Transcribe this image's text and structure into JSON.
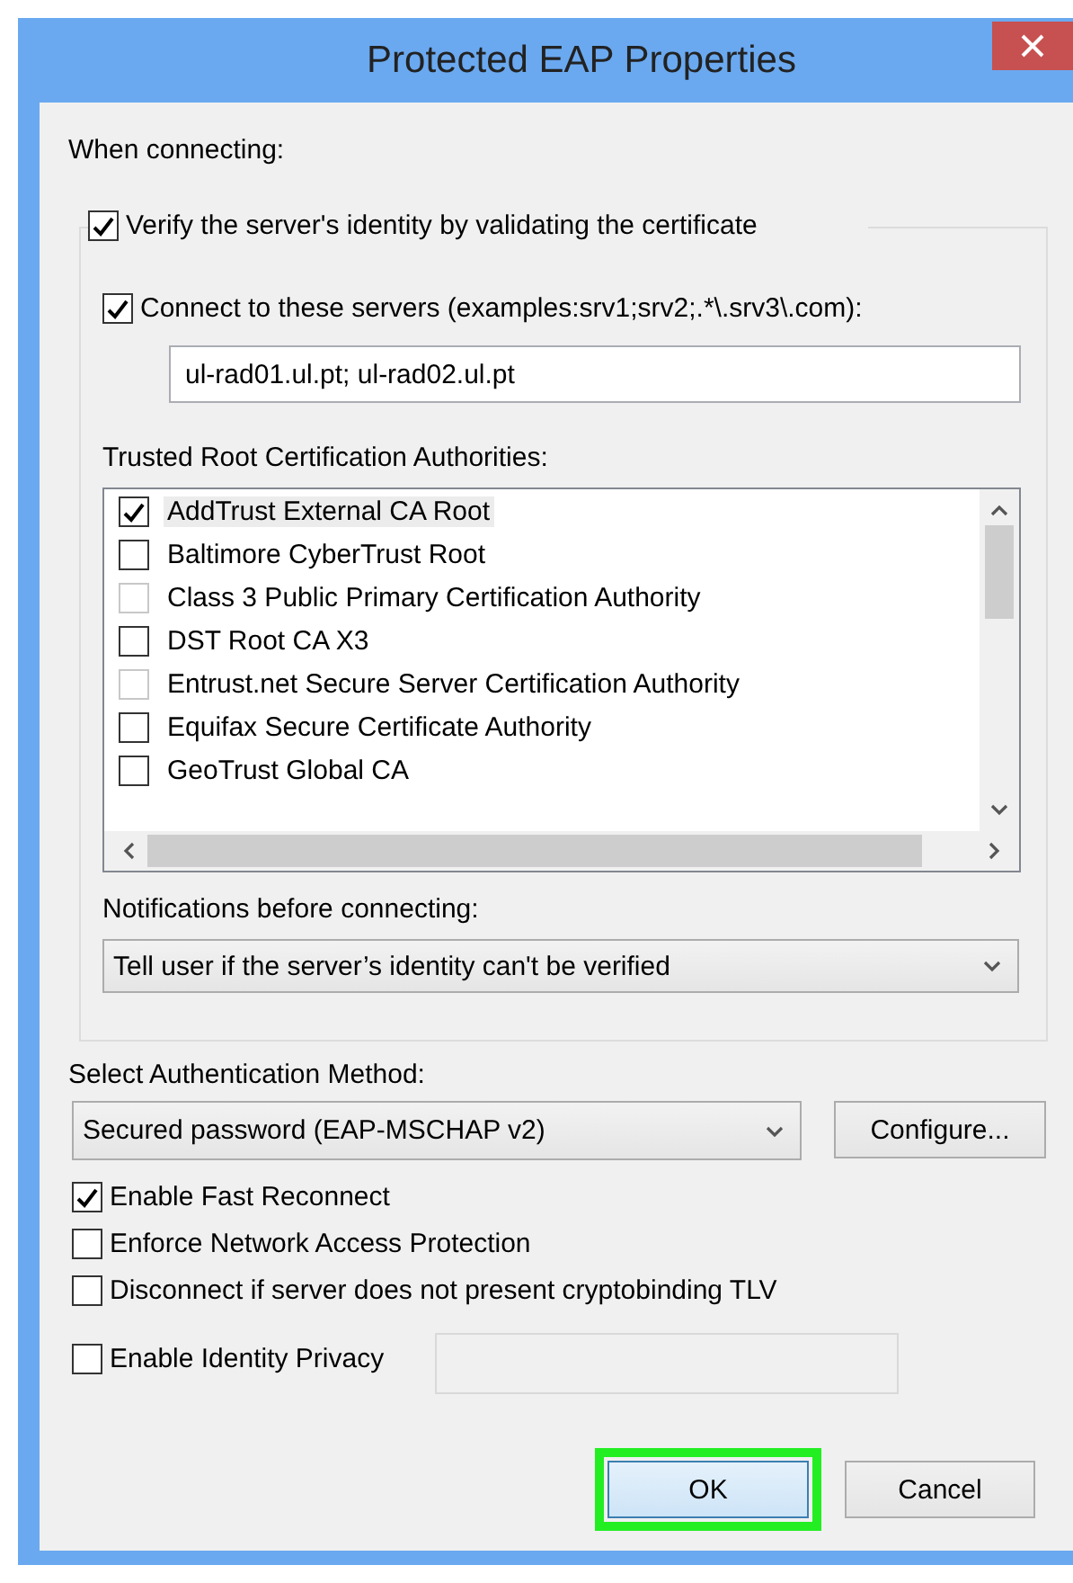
{
  "window": {
    "title": "Protected EAP Properties"
  },
  "when_connecting_label": "When connecting:",
  "verify_certificate": {
    "label": "Verify the server's identity by validating the certificate",
    "checked": true
  },
  "connect_to_servers": {
    "label": "Connect to these servers (examples:srv1;srv2;.*\\.srv3\\.com):",
    "checked": true
  },
  "servers_field": {
    "value": "ul-rad01.ul.pt; ul-rad02.ul.pt"
  },
  "trusted_roots": {
    "label": "Trusted Root Certification Authorities:",
    "items": [
      {
        "label": "AddTrust External CA Root",
        "checked": true,
        "disabled": false,
        "selected": true
      },
      {
        "label": "Baltimore CyberTrust Root",
        "checked": false,
        "disabled": false,
        "selected": false
      },
      {
        "label": "Class 3 Public Primary Certification Authority",
        "checked": false,
        "disabled": true,
        "selected": false
      },
      {
        "label": "DST Root CA X3",
        "checked": false,
        "disabled": false,
        "selected": false
      },
      {
        "label": "Entrust.net Secure Server Certification Authority",
        "checked": false,
        "disabled": true,
        "selected": false
      },
      {
        "label": "Equifax Secure Certificate Authority",
        "checked": false,
        "disabled": false,
        "selected": false
      },
      {
        "label": "GeoTrust Global CA",
        "checked": false,
        "disabled": false,
        "selected": false
      }
    ]
  },
  "notifications": {
    "label": "Notifications before connecting:",
    "value": "Tell user if the server’s identity can't be verified"
  },
  "auth_method": {
    "label": "Select Authentication Method:",
    "value": "Secured password (EAP-MSCHAP v2)",
    "configure_button": "Configure..."
  },
  "options": [
    {
      "label": "Enable Fast Reconnect",
      "checked": true
    },
    {
      "label": "Enforce Network Access Protection",
      "checked": false
    },
    {
      "label": "Disconnect if server does not present cryptobinding TLV",
      "checked": false
    },
    {
      "label": "Enable Identity Privacy",
      "checked": false,
      "kind": "with-field"
    }
  ],
  "buttons": [
    {
      "label": "OK",
      "highlighted": true
    },
    {
      "label": "Cancel",
      "highlighted": false
    }
  ]
}
